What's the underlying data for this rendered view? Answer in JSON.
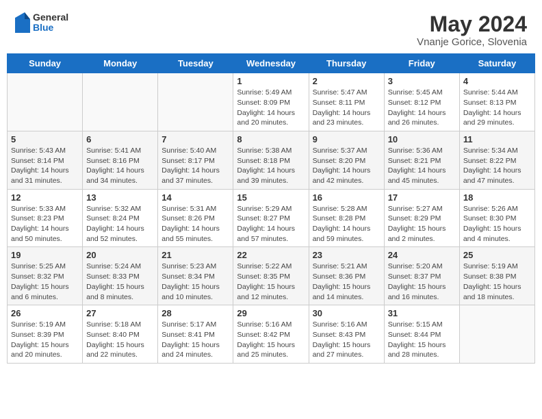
{
  "header": {
    "logo": {
      "general": "General",
      "blue": "Blue"
    },
    "title": "May 2024",
    "location": "Vnanje Gorice, Slovenia"
  },
  "weekdays": [
    "Sunday",
    "Monday",
    "Tuesday",
    "Wednesday",
    "Thursday",
    "Friday",
    "Saturday"
  ],
  "weeks": [
    [
      {
        "day": "",
        "info": ""
      },
      {
        "day": "",
        "info": ""
      },
      {
        "day": "",
        "info": ""
      },
      {
        "day": "1",
        "info": "Sunrise: 5:49 AM\nSunset: 8:09 PM\nDaylight: 14 hours\nand 20 minutes."
      },
      {
        "day": "2",
        "info": "Sunrise: 5:47 AM\nSunset: 8:11 PM\nDaylight: 14 hours\nand 23 minutes."
      },
      {
        "day": "3",
        "info": "Sunrise: 5:45 AM\nSunset: 8:12 PM\nDaylight: 14 hours\nand 26 minutes."
      },
      {
        "day": "4",
        "info": "Sunrise: 5:44 AM\nSunset: 8:13 PM\nDaylight: 14 hours\nand 29 minutes."
      }
    ],
    [
      {
        "day": "5",
        "info": "Sunrise: 5:43 AM\nSunset: 8:14 PM\nDaylight: 14 hours\nand 31 minutes."
      },
      {
        "day": "6",
        "info": "Sunrise: 5:41 AM\nSunset: 8:16 PM\nDaylight: 14 hours\nand 34 minutes."
      },
      {
        "day": "7",
        "info": "Sunrise: 5:40 AM\nSunset: 8:17 PM\nDaylight: 14 hours\nand 37 minutes."
      },
      {
        "day": "8",
        "info": "Sunrise: 5:38 AM\nSunset: 8:18 PM\nDaylight: 14 hours\nand 39 minutes."
      },
      {
        "day": "9",
        "info": "Sunrise: 5:37 AM\nSunset: 8:20 PM\nDaylight: 14 hours\nand 42 minutes."
      },
      {
        "day": "10",
        "info": "Sunrise: 5:36 AM\nSunset: 8:21 PM\nDaylight: 14 hours\nand 45 minutes."
      },
      {
        "day": "11",
        "info": "Sunrise: 5:34 AM\nSunset: 8:22 PM\nDaylight: 14 hours\nand 47 minutes."
      }
    ],
    [
      {
        "day": "12",
        "info": "Sunrise: 5:33 AM\nSunset: 8:23 PM\nDaylight: 14 hours\nand 50 minutes."
      },
      {
        "day": "13",
        "info": "Sunrise: 5:32 AM\nSunset: 8:24 PM\nDaylight: 14 hours\nand 52 minutes."
      },
      {
        "day": "14",
        "info": "Sunrise: 5:31 AM\nSunset: 8:26 PM\nDaylight: 14 hours\nand 55 minutes."
      },
      {
        "day": "15",
        "info": "Sunrise: 5:29 AM\nSunset: 8:27 PM\nDaylight: 14 hours\nand 57 minutes."
      },
      {
        "day": "16",
        "info": "Sunrise: 5:28 AM\nSunset: 8:28 PM\nDaylight: 14 hours\nand 59 minutes."
      },
      {
        "day": "17",
        "info": "Sunrise: 5:27 AM\nSunset: 8:29 PM\nDaylight: 15 hours\nand 2 minutes."
      },
      {
        "day": "18",
        "info": "Sunrise: 5:26 AM\nSunset: 8:30 PM\nDaylight: 15 hours\nand 4 minutes."
      }
    ],
    [
      {
        "day": "19",
        "info": "Sunrise: 5:25 AM\nSunset: 8:32 PM\nDaylight: 15 hours\nand 6 minutes."
      },
      {
        "day": "20",
        "info": "Sunrise: 5:24 AM\nSunset: 8:33 PM\nDaylight: 15 hours\nand 8 minutes."
      },
      {
        "day": "21",
        "info": "Sunrise: 5:23 AM\nSunset: 8:34 PM\nDaylight: 15 hours\nand 10 minutes."
      },
      {
        "day": "22",
        "info": "Sunrise: 5:22 AM\nSunset: 8:35 PM\nDaylight: 15 hours\nand 12 minutes."
      },
      {
        "day": "23",
        "info": "Sunrise: 5:21 AM\nSunset: 8:36 PM\nDaylight: 15 hours\nand 14 minutes."
      },
      {
        "day": "24",
        "info": "Sunrise: 5:20 AM\nSunset: 8:37 PM\nDaylight: 15 hours\nand 16 minutes."
      },
      {
        "day": "25",
        "info": "Sunrise: 5:19 AM\nSunset: 8:38 PM\nDaylight: 15 hours\nand 18 minutes."
      }
    ],
    [
      {
        "day": "26",
        "info": "Sunrise: 5:19 AM\nSunset: 8:39 PM\nDaylight: 15 hours\nand 20 minutes."
      },
      {
        "day": "27",
        "info": "Sunrise: 5:18 AM\nSunset: 8:40 PM\nDaylight: 15 hours\nand 22 minutes."
      },
      {
        "day": "28",
        "info": "Sunrise: 5:17 AM\nSunset: 8:41 PM\nDaylight: 15 hours\nand 24 minutes."
      },
      {
        "day": "29",
        "info": "Sunrise: 5:16 AM\nSunset: 8:42 PM\nDaylight: 15 hours\nand 25 minutes."
      },
      {
        "day": "30",
        "info": "Sunrise: 5:16 AM\nSunset: 8:43 PM\nDaylight: 15 hours\nand 27 minutes."
      },
      {
        "day": "31",
        "info": "Sunrise: 5:15 AM\nSunset: 8:44 PM\nDaylight: 15 hours\nand 28 minutes."
      },
      {
        "day": "",
        "info": ""
      }
    ]
  ]
}
